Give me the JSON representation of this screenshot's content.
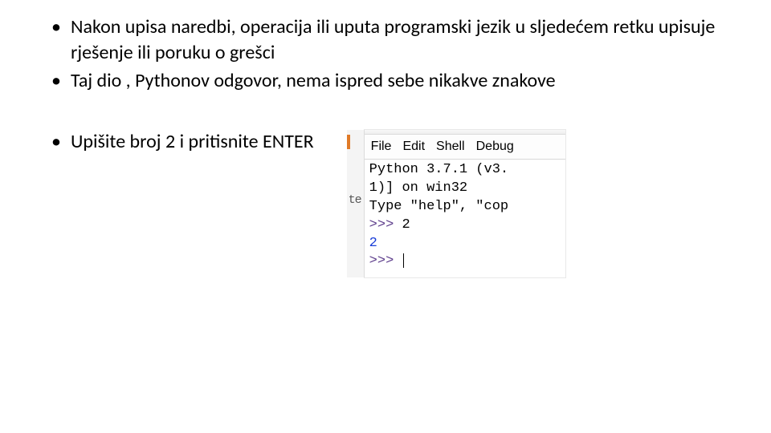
{
  "bullets": {
    "b1": "Nakon upisa naredbi, operacija ili uputa programski jezik  u sljedećem retku upisuje rješenje ili poruku o grešci",
    "b2": "Taj dio , Pythonov odgovor, nema ispred sebe nikakve znakove",
    "b3": "Upišite broj 2 i pritisnite ENTER"
  },
  "shell": {
    "left_fragment": "te",
    "menu": {
      "file": "File",
      "edit": "Edit",
      "shell": "Shell",
      "debug": "Debug"
    },
    "line1": "Python 3.7.1 (v3.",
    "line2": "1)] on win32",
    "line3": "Type \"help\", \"cop",
    "prompt": ">>>",
    "input_val": "2",
    "output_val": "2"
  }
}
